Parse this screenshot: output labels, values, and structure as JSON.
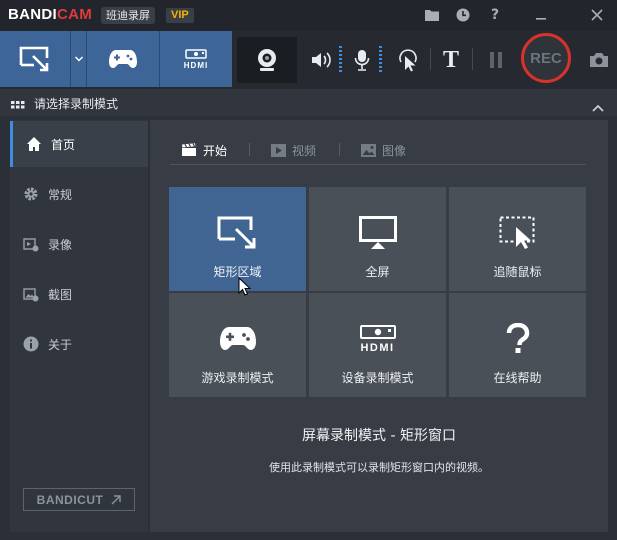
{
  "titlebar": {
    "brand_part1": "BANDI",
    "brand_part2": "CAM",
    "brand_cn": "班迪录屏",
    "vip": "VIP",
    "icons": [
      "folder-icon",
      "clock-icon",
      "help-icon",
      "minimize-icon",
      "close-icon"
    ]
  },
  "toolbar": {
    "hdmi_label": "HDMI",
    "text_tool": "T",
    "rec_label": "REC"
  },
  "section": {
    "title": "请选择录制模式"
  },
  "sidebar": {
    "items": [
      {
        "label": "首页",
        "icon": "home-icon",
        "active": true
      },
      {
        "label": "常规",
        "icon": "gear-icon",
        "active": false
      },
      {
        "label": "录像",
        "icon": "video-settings-icon",
        "active": false
      },
      {
        "label": "截图",
        "icon": "image-settings-icon",
        "active": false
      },
      {
        "label": "关于",
        "icon": "info-icon",
        "active": false
      }
    ],
    "bandicut_label": "BANDICUT"
  },
  "tabs": [
    {
      "label": "开始",
      "active": true
    },
    {
      "label": "视频",
      "active": false
    },
    {
      "label": "图像",
      "active": false
    }
  ],
  "tiles": [
    {
      "label": "矩形区域",
      "icon": "rectangle-area-icon",
      "selected": true
    },
    {
      "label": "全屏",
      "icon": "monitor-icon",
      "selected": false
    },
    {
      "label": "追随鼠标",
      "icon": "follow-mouse-icon",
      "selected": false
    },
    {
      "label": "游戏录制模式",
      "icon": "gamepad-icon",
      "selected": false
    },
    {
      "label": "设备录制模式",
      "icon": "hdmi-device-icon",
      "selected": false
    },
    {
      "label": "在线帮助",
      "icon": "question-icon",
      "selected": false
    }
  ],
  "tile_hdmi_label": "HDMI",
  "description": {
    "title": "屏幕录制模式 - 矩形窗口",
    "text": "使用此录制模式可以录制矩形窗口内的视频。"
  },
  "colors": {
    "accent": "#3d6597",
    "rec": "#d9312b",
    "brand_red": "#e03a3a",
    "vip": "#f0b400"
  }
}
